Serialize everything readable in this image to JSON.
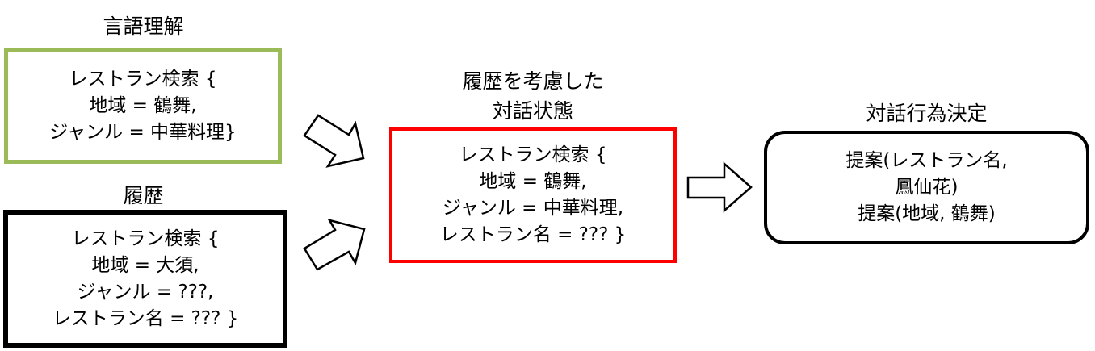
{
  "nlu": {
    "title": "言語理解",
    "lines": [
      "レストラン検索 {",
      "地域 = 鶴舞,",
      "ジャンル = 中華料理}"
    ]
  },
  "history": {
    "title": "履歴",
    "lines": [
      "レストラン検索 {",
      "地域 = 大須,",
      "ジャンル = ???,",
      "レストラン名 = ??? }"
    ]
  },
  "state": {
    "title_lines": [
      "履歴を考慮した",
      "対話状態"
    ],
    "lines": [
      "レストラン検索 {",
      "地域 = 鶴舞,",
      "ジャンル = 中華料理,",
      "レストラン名 = ??? }"
    ]
  },
  "action": {
    "title": "対話行為決定",
    "lines": [
      "提案(レストラン名,",
      "鳳仙花)",
      "提案(地域, 鶴舞)"
    ]
  },
  "colors": {
    "nlu_border": "#9bbb59",
    "state_border": "#ff0000",
    "border": "#000000"
  }
}
